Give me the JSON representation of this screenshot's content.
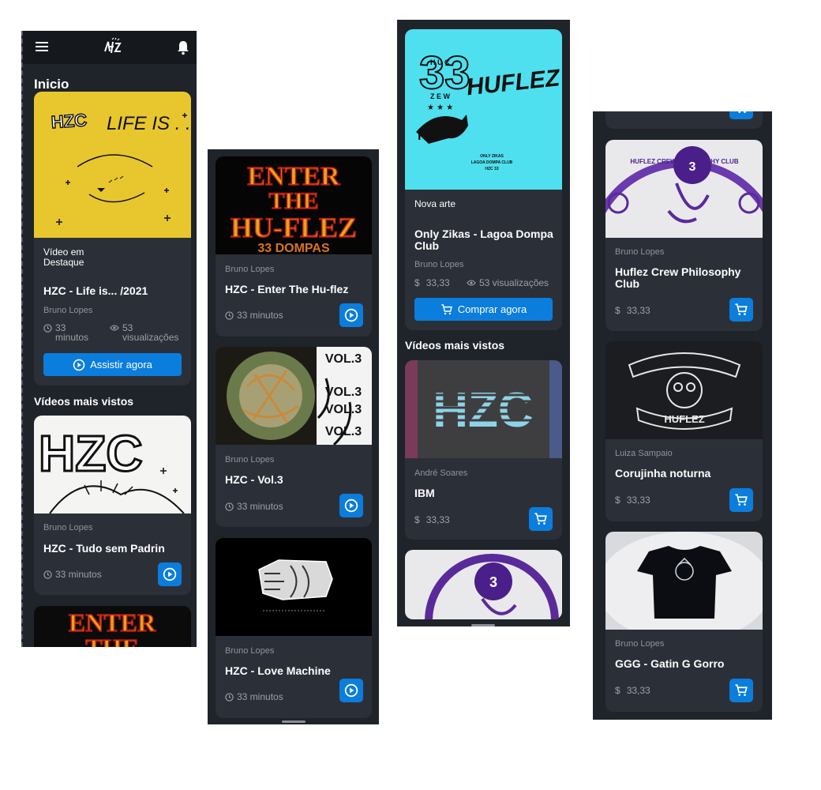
{
  "header": {
    "menu_icon": "menu-icon",
    "logo_icon": "hzc-logo",
    "notifications_icon": "bell-icon"
  },
  "home": {
    "title": "Inicio",
    "featured": {
      "tag": "Vídeo em Destaque",
      "title": "HZC - Life is... /2021",
      "author": "Bruno Lopes",
      "duration": "33 minutos",
      "views": "53 visualizações",
      "button": "Assistir agora",
      "thumb_text": "LIFE IS . . ."
    },
    "most_viewed_title": "Vídeos mais vistos"
  },
  "videos": [
    {
      "author": "Bruno Lopes",
      "title": "HZC - Tudo sem Padrin",
      "duration": "33 minutos",
      "thumb_text": "HZC"
    },
    {
      "author": "Bruno Lopes",
      "title": "HZC - Enter The Hu-flez",
      "duration": "33 minutos",
      "thumb_line1": "ENTER",
      "thumb_line2": "THE",
      "thumb_line3": "HU-FLEZ",
      "thumb_line4": "33 DOMPAS"
    },
    {
      "author": "Bruno Lopes",
      "title": "HZC - Vol.3",
      "duration": "33 minutos",
      "thumb_text": "VOL.3"
    },
    {
      "author": "Bruno Lopes",
      "title": "HZC - Love Machine",
      "duration": "33 minutos"
    }
  ],
  "featured_product": {
    "tag": "Nova arte",
    "title": "Only Zikas - Lagoa Dompa Club",
    "author": "Bruno Lopes",
    "price": "33,33",
    "views": "53 visualizações",
    "button": "Comprar agora",
    "thumb_brand": "HUFLEZ",
    "thumb_badge": "HZC",
    "thumb_caption_1": "ONLY ZIKAS",
    "thumb_caption_2": "LAGOA DOMPA CLUB"
  },
  "products_section_title": "Vídeos mais vistos",
  "products": [
    {
      "author": "André Soares",
      "title": "IBM",
      "price": "33,33",
      "thumb_text": "HZC"
    },
    {
      "author": "Bruno Lopes",
      "title": "Huflez Crew Philosophy Club",
      "price": "33,33",
      "thumb_text": "HUFLEZ CREW PHILOSOPHY CLUB"
    },
    {
      "author": "Luiza Sampaio",
      "title": "Corujinha noturna",
      "price": "33,33",
      "thumb_text": "HUFLEZ"
    },
    {
      "author": "Bruno Lopes",
      "title": "GGG - Gatin G Gorro",
      "price": "33,33"
    }
  ],
  "currency_symbol": "$",
  "colors": {
    "background": "#1f232a",
    "card": "#2b3038",
    "accent": "#0b7ddd",
    "yellow": "#e8c72e",
    "cyan": "#4fe0ef"
  }
}
